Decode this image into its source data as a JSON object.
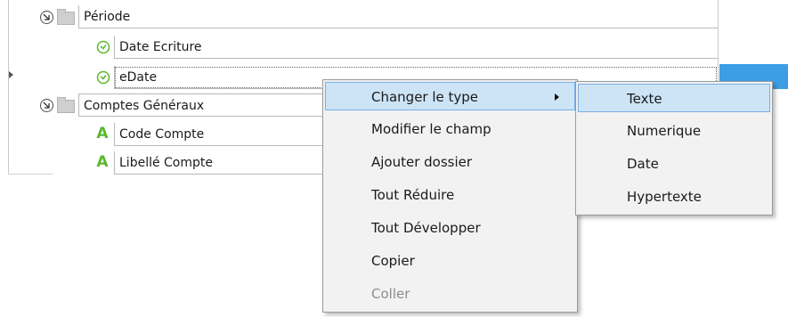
{
  "tree": {
    "rows": [
      {
        "label": "Période",
        "icon": "folder-icon",
        "expander": "collapse-icon"
      },
      {
        "label": "Date Ecriture",
        "icon": "clock-icon"
      },
      {
        "label": "eDate",
        "icon": "clock-icon",
        "focused": true
      },
      {
        "label": "Comptes Généraux",
        "icon": "folder-icon",
        "expander": "collapse-icon"
      },
      {
        "label": "Code Compte",
        "icon": "text-type-icon",
        "icon_glyph": "A"
      },
      {
        "label": "Libellé Compte",
        "icon": "text-type-icon",
        "icon_glyph": "A"
      }
    ]
  },
  "context_menu": {
    "items": [
      {
        "label": "Changer le type",
        "highlighted": true,
        "has_submenu": true
      },
      {
        "label": "Modifier le champ"
      },
      {
        "label": "Ajouter dossier"
      },
      {
        "label": "Tout Réduire"
      },
      {
        "label": "Tout Développer"
      },
      {
        "label": "Copier"
      },
      {
        "label": "Coller",
        "disabled": true
      }
    ]
  },
  "submenu": {
    "items": [
      {
        "label": "Texte",
        "highlighted": true
      },
      {
        "label": "Numerique"
      },
      {
        "label": "Date"
      },
      {
        "label": "Hypertexte"
      }
    ]
  },
  "colors": {
    "selection_blue": "#3c9ee4",
    "menu_highlight": "#cde4f7",
    "menu_highlight_border": "#78aee5",
    "clock_green": "#5ab82c",
    "text_icon_green": "#5ab82c",
    "disabled_text": "#8d8d8d"
  }
}
